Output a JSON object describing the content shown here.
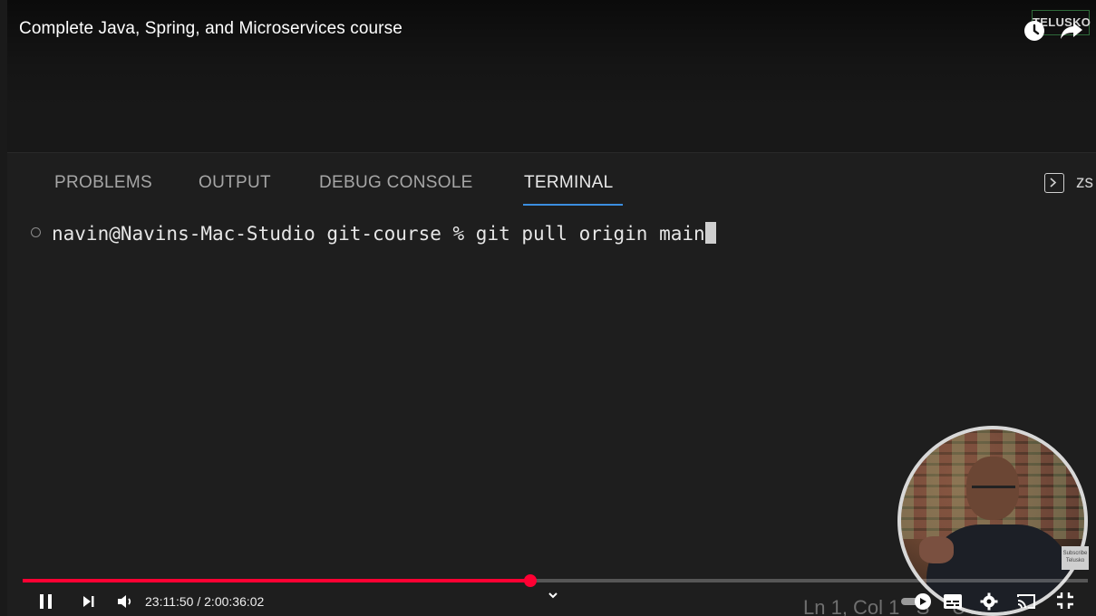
{
  "video": {
    "title": "Complete Java, Spring, and Microservices course",
    "watermark": "TELUSKO"
  },
  "panel": {
    "tabs": [
      "PROBLEMS",
      "OUTPUT",
      "DEBUG CONSOLE",
      "TERMINAL"
    ],
    "active_tab": "TERMINAL",
    "cut_label": "zs"
  },
  "terminal": {
    "prompt": "navin@Navins-Mac-Studio git-course % ",
    "command": "git pull origin main"
  },
  "status_bar": {
    "text": "Ln 1, Col 1   S    UTF"
  },
  "webcam": {
    "subscribe_text": "Subscribe Telusko"
  },
  "player": {
    "current_time": "23:11:50",
    "duration": "2:00:36:02",
    "time_separator": " / ",
    "progress_fraction": 0.477,
    "accent_color": "#ff0033"
  },
  "icons": {
    "top": [
      "clock-icon",
      "share-icon"
    ],
    "controls_left": [
      "pause-icon",
      "next-icon",
      "volume-icon"
    ],
    "controls_right": [
      "autoplay-toggle-icon",
      "captions-icon",
      "settings-icon",
      "cast-icon",
      "exit-fullscreen-icon"
    ]
  }
}
